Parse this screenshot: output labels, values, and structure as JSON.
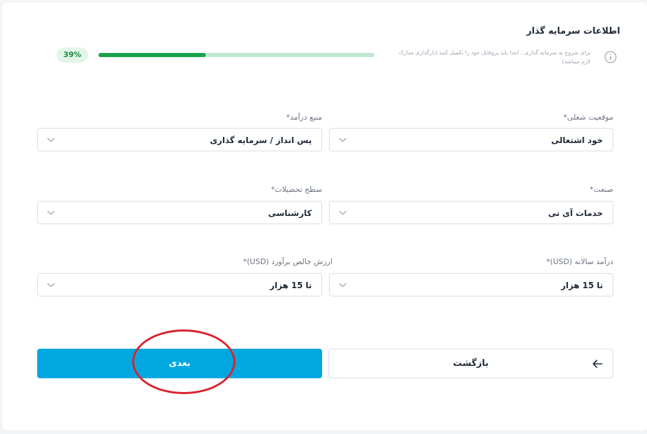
{
  "header": {
    "title": "اطلاعات سرمایه گذار",
    "helper_text": "برای شروع به سرمایه گذاری ، ابتدا باید پروفایل خود را تکمیل کنید.(بارگذاری مدارک لازم میباشد)",
    "progress_label": "39%",
    "progress_fraction": 0.39,
    "info_icon": "info-circle-icon"
  },
  "form": {
    "fields": [
      {
        "label": "موقعیت شغلی*",
        "value": "خود اشتغالی"
      },
      {
        "label": "منبع درآمد*",
        "value": "پس انداز / سرمایه گذاری"
      },
      {
        "label": "صنعت*",
        "value": "خدمات آی تی"
      },
      {
        "label": "سطح تحصیلات*",
        "value": "کارشناسی"
      },
      {
        "label": "درآمد سالانه (USD)*",
        "value": "تا 15 هزار"
      },
      {
        "label": "ارزش خالص برآورد (USD)*",
        "value": "تا 15 هزار"
      }
    ],
    "dropdown_icon": "chevron-down-icon"
  },
  "actions": {
    "next_label": "بعدی",
    "back_label": "بازگشت",
    "back_icon": "arrow-left-icon"
  },
  "colors": {
    "primary": "#01a8e0",
    "progress": "#1aa34a",
    "annotation": "#d9232e"
  }
}
